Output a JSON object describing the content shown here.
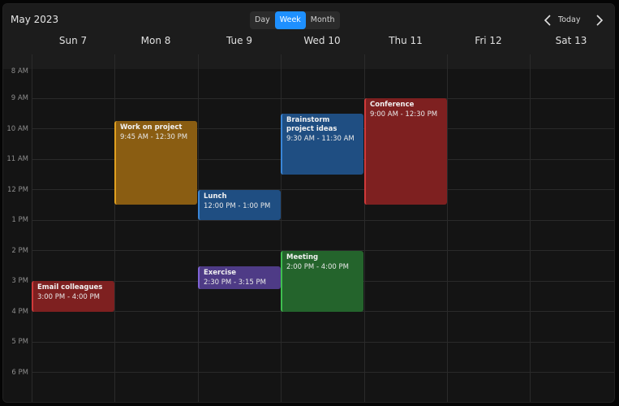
{
  "header": {
    "title": "May 2023",
    "views": [
      "Day",
      "Week",
      "Month"
    ],
    "active_view": "Week",
    "today_label": "Today"
  },
  "days": [
    "Sun 7",
    "Mon 8",
    "Tue 9",
    "Wed 10",
    "Thu 11",
    "Fri 12",
    "Sat 13"
  ],
  "hours": [
    "8 AM",
    "9 AM",
    "10 AM",
    "11 AM",
    "12 PM",
    "1 PM",
    "2 PM",
    "3 PM",
    "4 PM",
    "5 PM",
    "6 PM"
  ],
  "events": [
    {
      "title": "Work on project",
      "time": "9:45 AM - 12:30 PM",
      "color": "#8a5d12",
      "accent": "#e0a020"
    },
    {
      "title": "Lunch",
      "time": "12:00 PM - 1:00 PM",
      "color": "#1f4e82",
      "accent": "#3a86d8"
    },
    {
      "title": "Brainstorm project ideas",
      "time": "9:30 AM - 11:30 AM",
      "color": "#1f4e82",
      "accent": "#3a86d8"
    },
    {
      "title": "Conference",
      "time": "9:00 AM - 12:30 PM",
      "color": "#7e2020",
      "accent": "#d03a3a"
    },
    {
      "title": "Exercise",
      "time": "2:30 PM - 3:15 PM",
      "color": "#4e3b86",
      "accent": "#7f63d6"
    },
    {
      "title": "Meeting",
      "time": "2:00 PM - 4:00 PM",
      "color": "#24642c",
      "accent": "#3fbf4f"
    },
    {
      "title": "Email colleagues",
      "time": "3:00 PM - 4:00 PM",
      "color": "#7e2020",
      "accent": "#d03a3a"
    }
  ]
}
